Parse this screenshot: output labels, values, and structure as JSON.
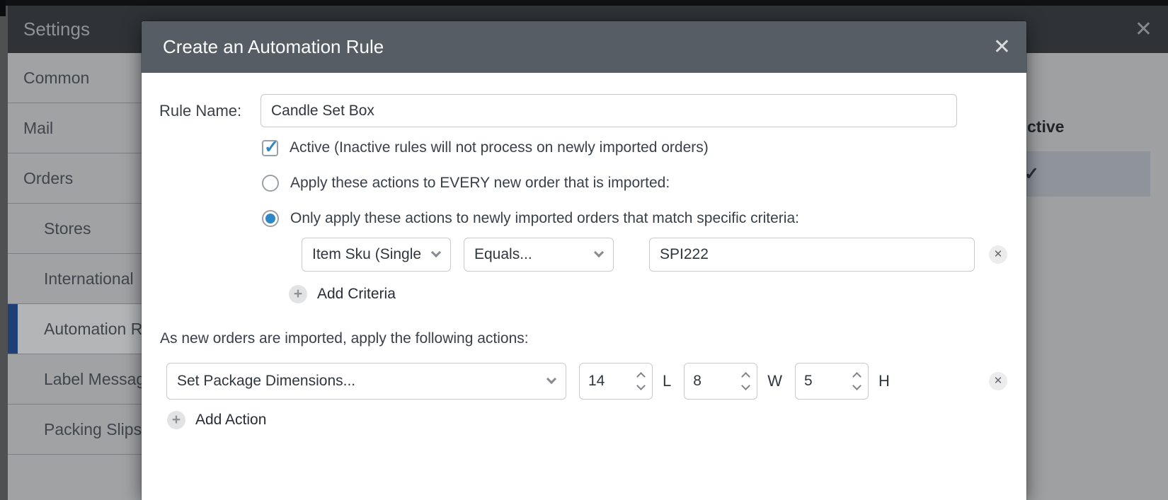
{
  "colors": {
    "accent_blue": "#2e87c6",
    "nav_selected_bar": "#1e4077",
    "modal_header_bg": "#575d65",
    "settings_header_bg": "#2f3338"
  },
  "settings": {
    "title": "Settings",
    "close_icon": "✕",
    "sidebar": {
      "items": [
        {
          "label": "Common"
        },
        {
          "label": "Mail"
        },
        {
          "label": "Orders"
        },
        {
          "label": "Stores"
        },
        {
          "label": "International"
        },
        {
          "label": "Automation R"
        },
        {
          "label": "Label Messag"
        },
        {
          "label": "Packing Slips"
        }
      ]
    },
    "content": {
      "active_header_partial": "ctive",
      "row_check_icon": "✓"
    }
  },
  "modal": {
    "title": "Create an Automation Rule",
    "close_icon": "✕",
    "rule_name": {
      "label": "Rule Name:",
      "value": "Candle Set Box"
    },
    "active_checkbox": {
      "checked": true,
      "check_icon": "✓",
      "label": "Active (Inactive rules will not process on newly imported orders)"
    },
    "radio_every": {
      "selected": false,
      "label": "Apply these actions to EVERY new order that is imported:"
    },
    "radio_criteria": {
      "selected": true,
      "label": "Only apply these actions to newly imported orders that match specific criteria:"
    },
    "criteria": {
      "field_selected": "Item Sku (Single",
      "operator_selected": "Equals...",
      "value": "SPI222",
      "remove_icon": "✕",
      "plus_icon": "+",
      "add_label": "Add Criteria"
    },
    "actions_heading": "As new orders are imported, apply the following actions:",
    "action": {
      "type_selected": "Set Package Dimensions...",
      "dims": [
        {
          "value": "14",
          "label": "L"
        },
        {
          "value": "8",
          "label": "W"
        },
        {
          "value": "5",
          "label": "H"
        }
      ],
      "remove_icon": "✕",
      "plus_icon": "+",
      "add_label": "Add Action"
    }
  }
}
